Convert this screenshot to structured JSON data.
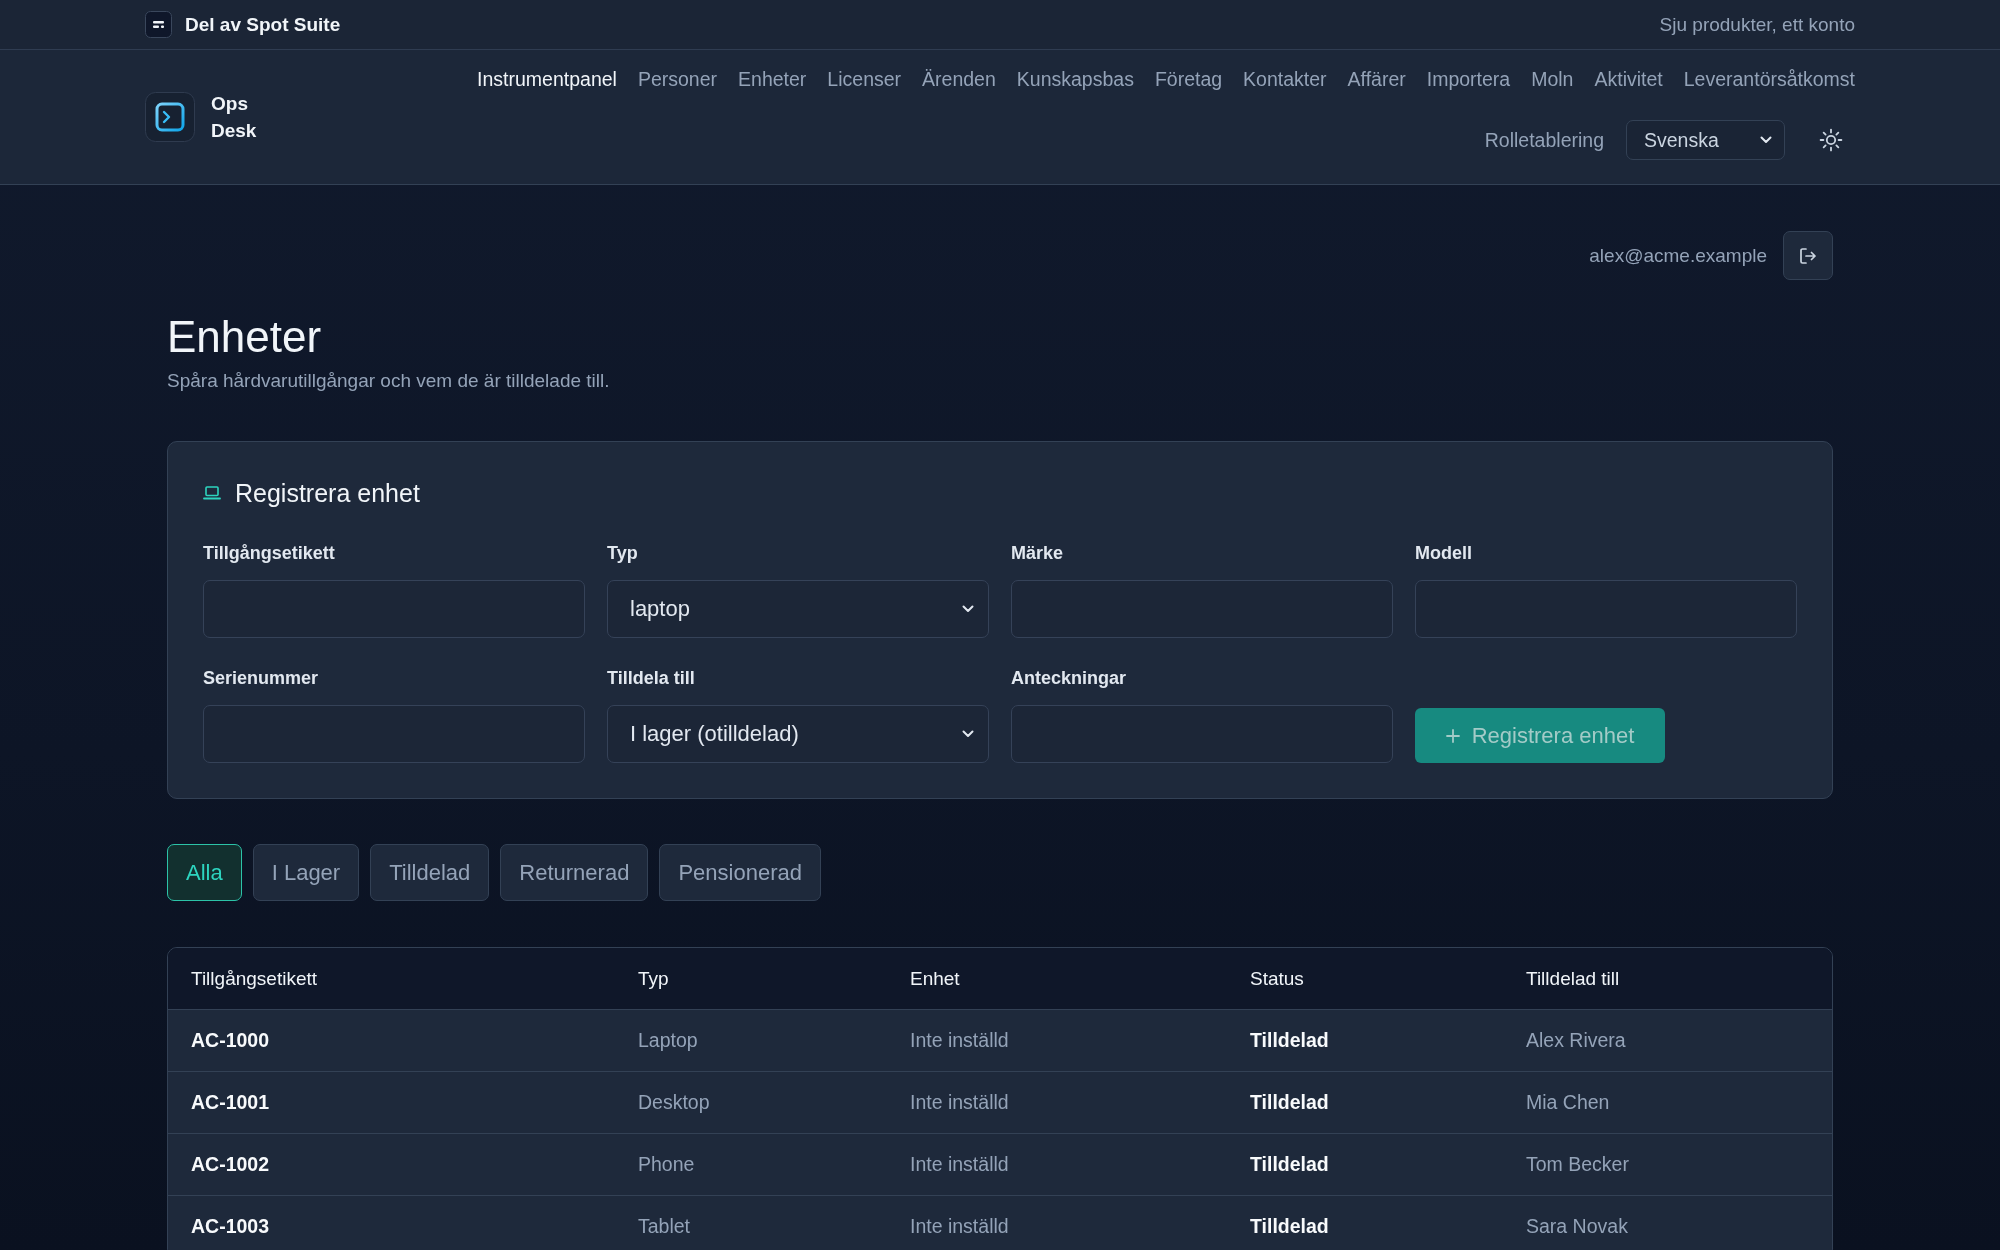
{
  "suite_bar": {
    "title": "Del av Spot Suite",
    "tagline": "Sju produkter, ett konto"
  },
  "header": {
    "app_name": "Ops Desk",
    "nav": [
      {
        "label": "Instrumentpanel",
        "selected": true
      },
      {
        "label": "Personer",
        "selected": false
      },
      {
        "label": "Enheter",
        "selected": false
      },
      {
        "label": "Licenser",
        "selected": false
      },
      {
        "label": "Ärenden",
        "selected": false
      },
      {
        "label": "Kunskapsbas",
        "selected": false
      },
      {
        "label": "Företag",
        "selected": false
      },
      {
        "label": "Kontakter",
        "selected": false
      },
      {
        "label": "Affärer",
        "selected": false
      },
      {
        "label": "Importera",
        "selected": false
      },
      {
        "label": "Moln",
        "selected": false
      },
      {
        "label": "Aktivitet",
        "selected": false
      },
      {
        "label": "Leverantörsåtkomst",
        "selected": false
      }
    ],
    "role_link": "Rolletablering",
    "language": "Svenska"
  },
  "user": {
    "email": "alex@acme.example"
  },
  "page": {
    "title": "Enheter",
    "subtitle": "Spåra hårdvarutillgångar och vem de är tilldelade till."
  },
  "form": {
    "title": "Registrera enhet",
    "fields": [
      {
        "label": "Tillgångsetikett",
        "kind": "text"
      },
      {
        "label": "Typ",
        "kind": "select",
        "value": "laptop"
      },
      {
        "label": "Märke",
        "kind": "text"
      },
      {
        "label": "Modell",
        "kind": "text"
      },
      {
        "label": "Serienummer",
        "kind": "text"
      },
      {
        "label": "Tilldela till",
        "kind": "select",
        "value": "I lager (otilldelad)"
      },
      {
        "label": "Anteckningar",
        "kind": "text"
      }
    ],
    "submit": {
      "label": "Registrera enhet",
      "disabled": true
    }
  },
  "filters": [
    {
      "label": "Alla",
      "selected": true
    },
    {
      "label": "I Lager",
      "selected": false
    },
    {
      "label": "Tilldelad",
      "selected": false
    },
    {
      "label": "Returnerad",
      "selected": false
    },
    {
      "label": "Pensionerad",
      "selected": false
    }
  ],
  "table": {
    "columns": [
      {
        "label": "Tillgångsetikett",
        "kind": "strong"
      },
      {
        "label": "Typ",
        "kind": "muted"
      },
      {
        "label": "Enhet",
        "kind": "muted"
      },
      {
        "label": "Status",
        "kind": "strong"
      },
      {
        "label": "Tilldelad till",
        "kind": "muted"
      }
    ],
    "rows": [
      [
        "AC-1000",
        "Laptop",
        "Inte inställd",
        "Tilldelad",
        "Alex Rivera"
      ],
      [
        "AC-1001",
        "Desktop",
        "Inte inställd",
        "Tilldelad",
        "Mia Chen"
      ],
      [
        "AC-1002",
        "Phone",
        "Inte inställd",
        "Tilldelad",
        "Tom Becker"
      ],
      [
        "AC-1003",
        "Tablet",
        "Inte inställd",
        "Tilldelad",
        "Sara Novak"
      ]
    ]
  }
}
